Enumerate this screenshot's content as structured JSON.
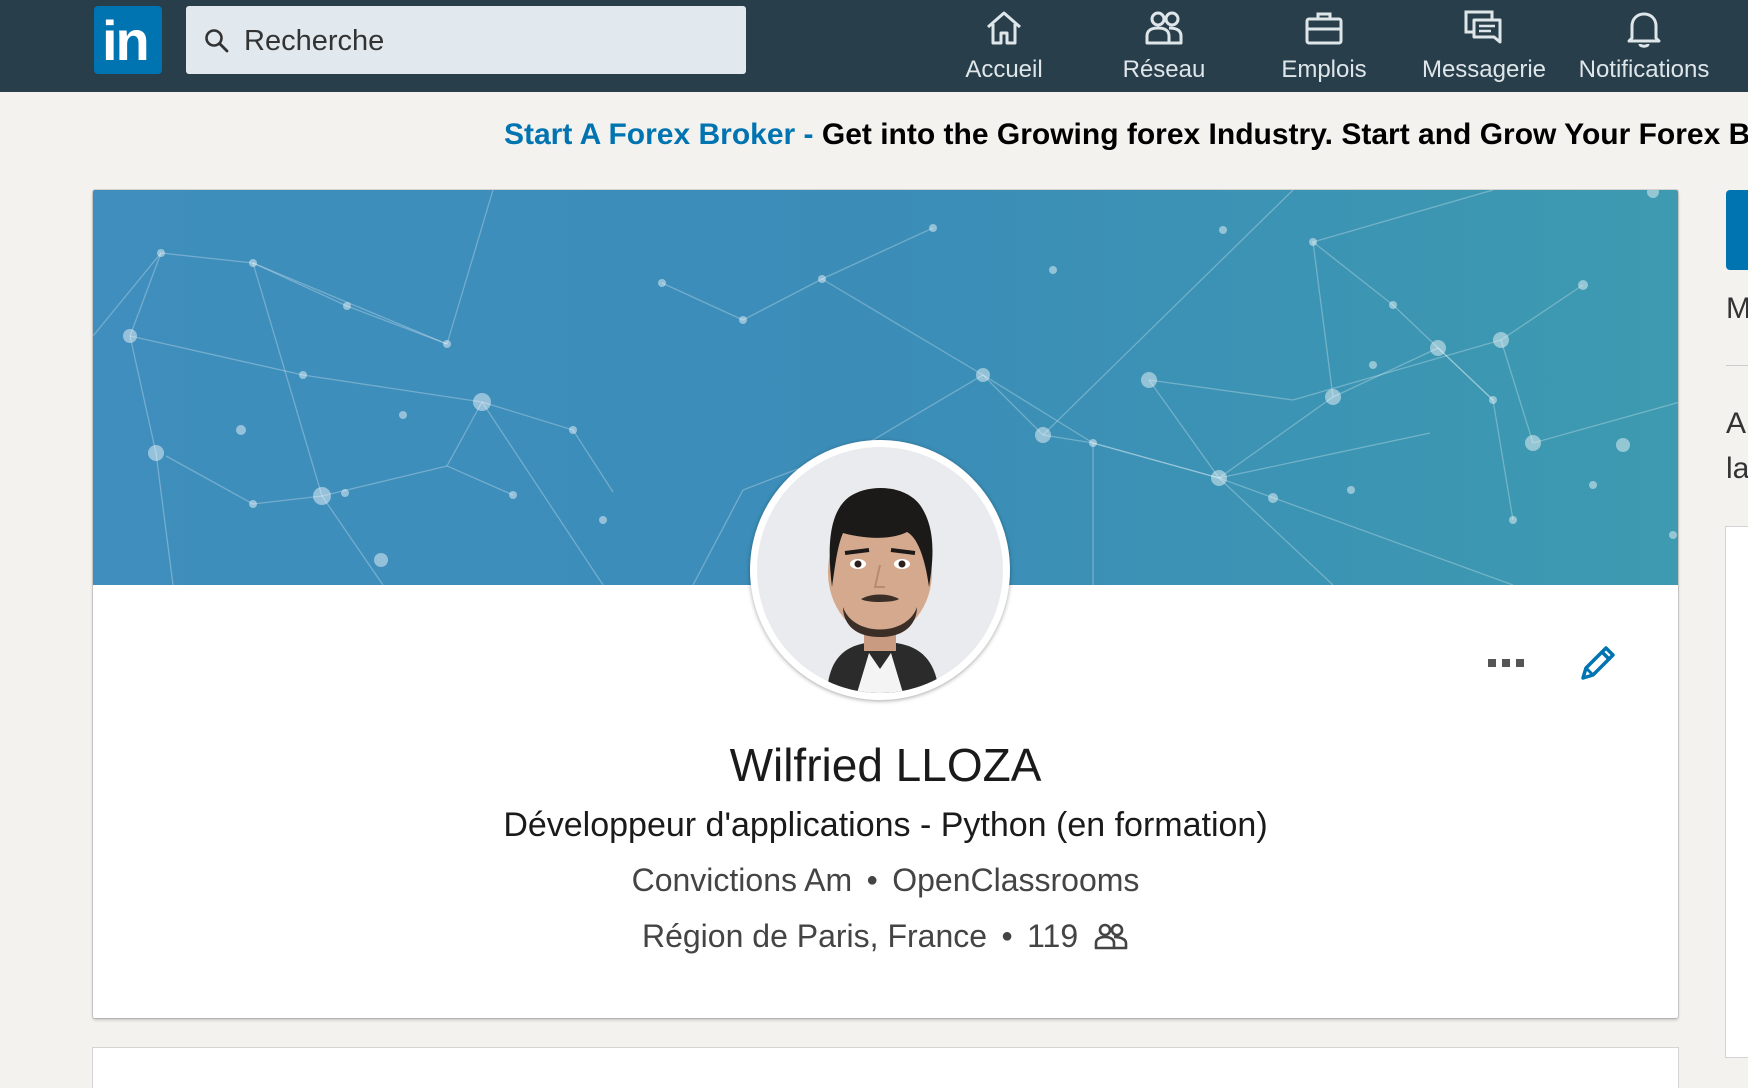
{
  "nav": {
    "logo": "in",
    "search_placeholder": "Recherche",
    "items": [
      {
        "label": "Accueil",
        "icon": "home-icon"
      },
      {
        "label": "Réseau",
        "icon": "network-icon"
      },
      {
        "label": "Emplois",
        "icon": "briefcase-icon"
      },
      {
        "label": "Messagerie",
        "icon": "messaging-icon"
      },
      {
        "label": "Notifications",
        "icon": "bell-icon"
      }
    ]
  },
  "ad": {
    "link": "Start A Forex Broker -",
    "text": "Get into the Growing forex Industry. Start and Grow Your Forex B"
  },
  "profile": {
    "name": "Wilfried LLOZA",
    "headline": "Développeur d'applications - Python (en formation)",
    "company": "Convictions Am",
    "school": "OpenClassrooms",
    "location": "Région de Paris, France",
    "connections": "119"
  },
  "right_column": {
    "line1": "M",
    "line2": "A",
    "line3": "la"
  },
  "colors": {
    "nav_bg": "#283e4a",
    "brand": "#0073b1",
    "page_bg": "#f3f2ef"
  }
}
